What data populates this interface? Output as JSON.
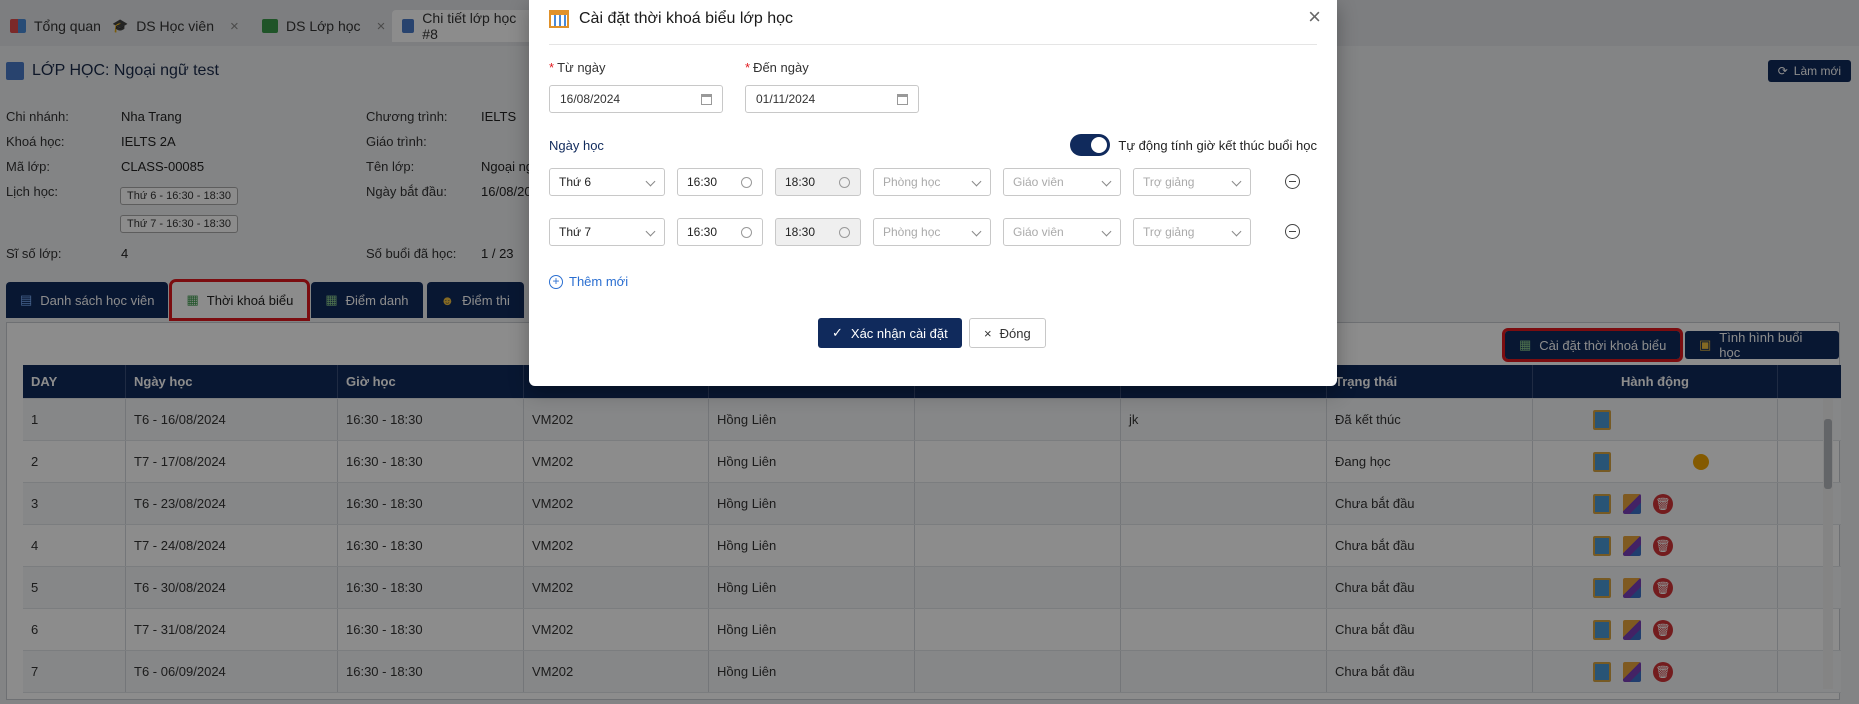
{
  "tabs": [
    {
      "label": "Tổng quan",
      "active": false,
      "closable": false
    },
    {
      "label": "DS Học viên",
      "active": false,
      "closable": true
    },
    {
      "label": "DS Lớp học",
      "active": false,
      "closable": true
    },
    {
      "label": "Chi tiết lớp học #8",
      "active": true,
      "closable": false
    }
  ],
  "page": {
    "title": "LỚP HỌC: Ngoại ngữ test",
    "refresh_label": "Làm mới"
  },
  "info": {
    "branch_label": "Chi nhánh:",
    "branch_value": "Nha Trang",
    "course_label": "Khoá học:",
    "course_value": "IELTS 2A",
    "code_label": "Mã lớp:",
    "code_value": "CLASS-00085",
    "schedule_label": "Lịch học:",
    "schedule_values": [
      "Thứ 6 - 16:30 - 18:30",
      "Thứ 7 - 16:30 - 18:30"
    ],
    "size_label": "Sĩ số lớp:",
    "size_value": "4",
    "program_label": "Chương trình:",
    "program_value": "IELTS",
    "textbook_label": "Giáo trình:",
    "textbook_value": "",
    "classname_label": "Tên lớp:",
    "classname_value": "Ngoại ng",
    "start_label": "Ngày bắt đầu:",
    "start_value": "16/08/20",
    "sessions_label": "Số buổi đã học:",
    "sessions_value": "1 / 23"
  },
  "subtabs": [
    {
      "label": "Danh sách học viên",
      "active": false
    },
    {
      "label": "Thời khoá biểu",
      "active": true
    },
    {
      "label": "Điểm danh",
      "active": false
    },
    {
      "label": "Điểm thi",
      "active": false
    }
  ],
  "actions": {
    "setup_label": "Cài đặt thời khoá biểu",
    "status_label": "Tình hình buổi học"
  },
  "table": {
    "headers": [
      "DAY",
      "Ngày học",
      "Giờ học",
      "",
      "",
      "",
      "",
      "Trạng thái",
      "Hành động"
    ],
    "rows": [
      {
        "day": "1",
        "date": "T6 - 16/08/2024",
        "time": "16:30 - 18:30",
        "room": "VM202",
        "teacher": "Hồng Liên",
        "c6": "",
        "note": "jk",
        "status": "Đã kết thúc",
        "actions": "view"
      },
      {
        "day": "2",
        "date": "T7 - 17/08/2024",
        "time": "16:30 - 18:30",
        "room": "VM202",
        "teacher": "Hồng Liên",
        "c6": "",
        "note": "",
        "status": "Đang học",
        "actions": "view-medal"
      },
      {
        "day": "3",
        "date": "T6 - 23/08/2024",
        "time": "16:30 - 18:30",
        "room": "VM202",
        "teacher": "Hồng Liên",
        "c6": "",
        "note": "",
        "status": "Chưa bắt đầu",
        "actions": "full"
      },
      {
        "day": "4",
        "date": "T7 - 24/08/2024",
        "time": "16:30 - 18:30",
        "room": "VM202",
        "teacher": "Hồng Liên",
        "c6": "",
        "note": "",
        "status": "Chưa bắt đầu",
        "actions": "full"
      },
      {
        "day": "5",
        "date": "T6 - 30/08/2024",
        "time": "16:30 - 18:30",
        "room": "VM202",
        "teacher": "Hồng Liên",
        "c6": "",
        "note": "",
        "status": "Chưa bắt đầu",
        "actions": "full"
      },
      {
        "day": "6",
        "date": "T7 - 31/08/2024",
        "time": "16:30 - 18:30",
        "room": "VM202",
        "teacher": "Hồng Liên",
        "c6": "",
        "note": "",
        "status": "Chưa bắt đầu",
        "actions": "full"
      },
      {
        "day": "7",
        "date": "T6 - 06/09/2024",
        "time": "16:30 - 18:30",
        "room": "VM202",
        "teacher": "Hồng Liên",
        "c6": "",
        "note": "",
        "status": "Chưa bắt đầu",
        "actions": "full"
      }
    ]
  },
  "modal": {
    "title": "Cài đặt thời khoá biểu lớp học",
    "from_label": "Từ ngày",
    "from_value": "16/08/2024",
    "to_label": "Đến ngày",
    "to_value": "01/11/2024",
    "section_label": "Ngày học",
    "toggle_label": "Tự động tính giờ kết thúc buổi học",
    "toggle_on": true,
    "schedule_rows": [
      {
        "day": "Thứ 6",
        "start": "16:30",
        "end": "18:30",
        "room_placeholder": "Phòng học",
        "teacher_placeholder": "Giáo viên",
        "assistant_placeholder": "Trợ giảng"
      },
      {
        "day": "Thứ 7",
        "start": "16:30",
        "end": "18:30",
        "room_placeholder": "Phòng học",
        "teacher_placeholder": "Giáo viên",
        "assistant_placeholder": "Trợ giảng"
      }
    ],
    "add_label": "Thêm mới",
    "confirm_label": "Xác nhận cài đặt",
    "close_label": "Đóng"
  }
}
